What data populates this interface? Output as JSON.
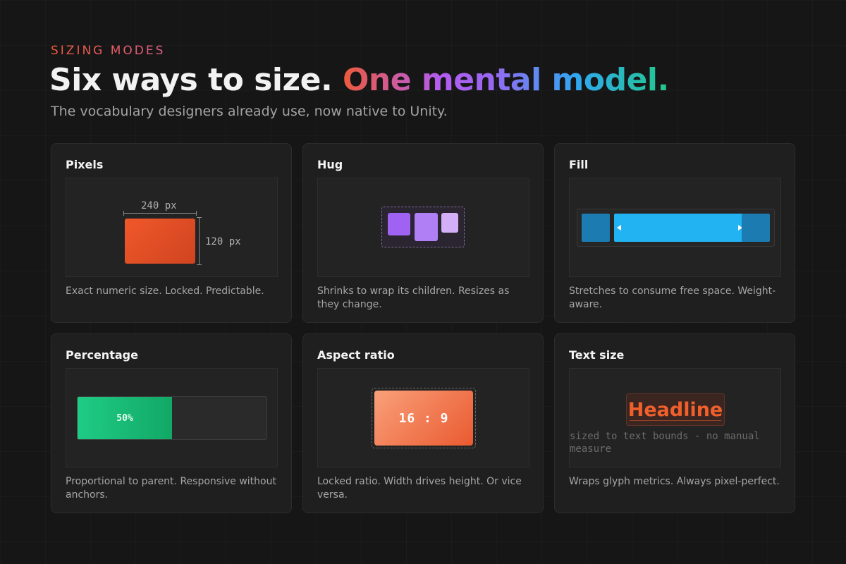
{
  "header": {
    "eyebrow": "SIZING MODES",
    "headline_plain": "Six ways to size. ",
    "headline_accent": "One mental model.",
    "subtitle": "The vocabulary designers already use, now native to Unity."
  },
  "cards": {
    "pixels": {
      "title": "Pixels",
      "width_label": "240 px",
      "height_label": "120 px",
      "description": "Exact numeric size. Locked. Predictable."
    },
    "hug": {
      "title": "Hug",
      "description": "Shrinks to wrap its children. Resizes as they change."
    },
    "fill": {
      "title": "Fill",
      "description": "Stretches to consume free space. Weight-aware."
    },
    "percentage": {
      "title": "Percentage",
      "value_label": "50%",
      "value_fraction": 0.5,
      "description": "Proportional to parent. Responsive without anchors."
    },
    "aspect": {
      "title": "Aspect ratio",
      "ratio_label": "16 : 9",
      "description": "Locked ratio. Width drives height. Or vice versa."
    },
    "text_size": {
      "title": "Text size",
      "sample": "Headline",
      "caption": "sized to text bounds - no manual measure",
      "description": "Wraps glyph metrics. Always pixel-perfect."
    }
  },
  "colors": {
    "background": "#161616",
    "pixels_accent": "#f0582a",
    "hug_accent": "#9f62f2",
    "fill_accent": "#22b3f2",
    "percentage_accent": "#1fcc85",
    "text_accent": "#f0602c"
  },
  "icons": [
    "arrow-left-icon",
    "arrow-right-icon"
  ]
}
